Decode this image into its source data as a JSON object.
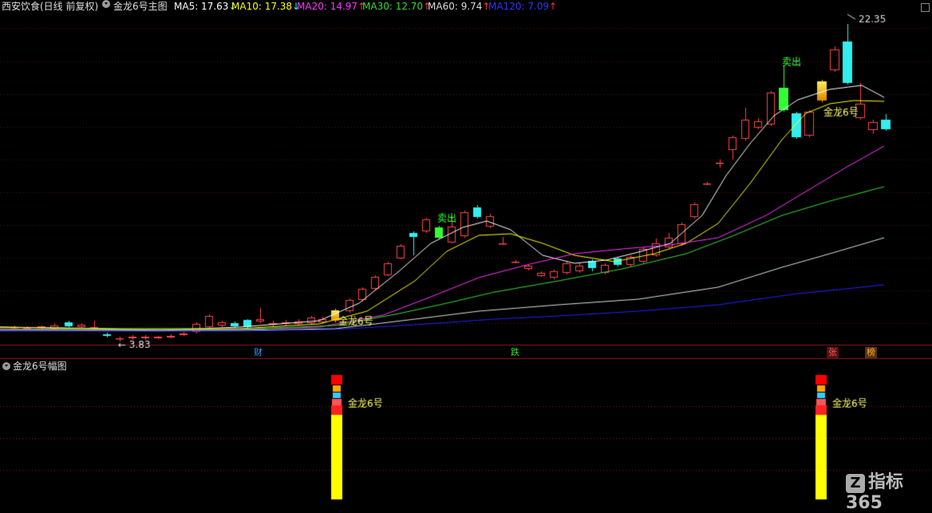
{
  "header": {
    "stock": "西安饮食(日线 前复权)",
    "indicator": "金龙6号主图",
    "ma": [
      {
        "label": "MA5: 17.63",
        "arrow": "↓",
        "color": "#ffffff",
        "arrow_color": "#00ffff"
      },
      {
        "label": "MA10: 17.38",
        "arrow": "↓",
        "color": "#ffff00",
        "arrow_color": "#00ffff"
      },
      {
        "label": "MA20: 14.97",
        "arrow": "↑",
        "color": "#ff33ff",
        "arrow_color": "#ff3333"
      },
      {
        "label": "MA30: 12.70",
        "arrow": "↑",
        "color": "#33dd33",
        "arrow_color": "#ff3333"
      },
      {
        "label": "MA60: 9.74",
        "arrow": "↑",
        "color": "#dddddd",
        "arrow_color": "#ff3333"
      },
      {
        "label": "MA120: 7.09",
        "arrow": "↑",
        "color": "#3333ff",
        "arrow_color": "#ff3333"
      }
    ]
  },
  "sub_panel": {
    "title": "金龙6号幅图"
  },
  "chart_data": {
    "type": "candlestick",
    "high_label": "22.35",
    "low_label": "3.83",
    "sell_label": "卖出",
    "signal_label": "金龙6号",
    "flags": [
      {
        "text": "财",
        "color": "#3399ff",
        "bg": "#000000"
      },
      {
        "text": "跌",
        "color": "#33dd33",
        "bg": "#000000"
      },
      {
        "text": "张",
        "color": "#ff5555",
        "bg": "#551111"
      },
      {
        "text": "榜",
        "color": "#ffaa33",
        "bg": "#553311"
      }
    ],
    "colors": {
      "up": "#ff4444",
      "down": "#33eeee",
      "sell": "#33ff33",
      "signal": "#ffcc00",
      "bar_top": "#ff0000",
      "bar_body": "#ffff00"
    }
  },
  "watermark": {
    "icon": "Z",
    "text": "指标365"
  }
}
